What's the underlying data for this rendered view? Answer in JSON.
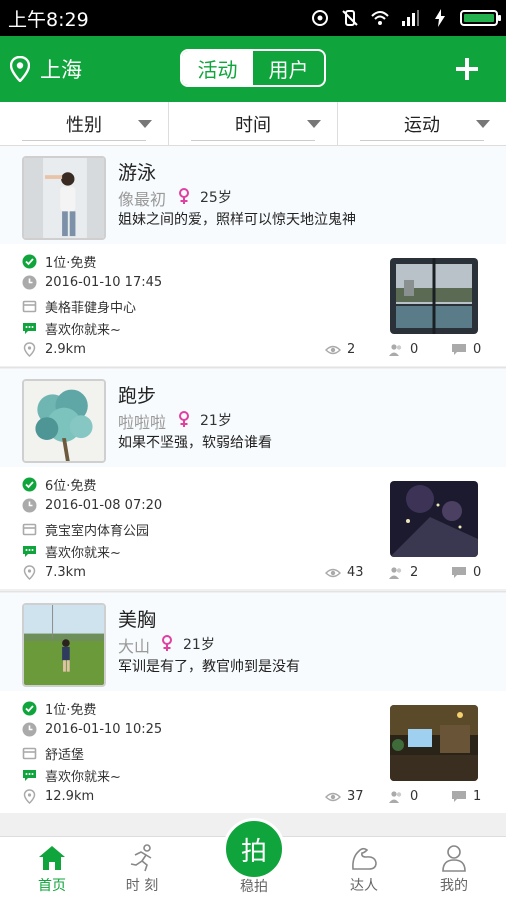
{
  "status_bar": {
    "time": "上午8:29"
  },
  "header": {
    "location": "上海",
    "tabs": [
      {
        "label": "活动"
      },
      {
        "label": "用户"
      }
    ]
  },
  "filters": [
    {
      "label": "性别"
    },
    {
      "label": "时间"
    },
    {
      "label": "运动"
    }
  ],
  "colors": {
    "brand": "#10a53c",
    "gender_female": "#e040a0"
  },
  "activities": [
    {
      "title": "游泳",
      "name": "像最初",
      "age": "25岁",
      "quote": "姐妹之间的爱，照样可以惊天地泣鬼神",
      "slots": "1位·免费",
      "datetime": "2016-01-10 17:45",
      "venue": "美格菲健身中心",
      "note": "喜欢你就来~",
      "distance": "2.9km",
      "views": "2",
      "participants": "0",
      "comments": "0"
    },
    {
      "title": "跑步",
      "name": "啦啦啦",
      "age": "21岁",
      "quote": "如果不坚强，软弱给谁看",
      "slots": "6位·免费",
      "datetime": "2016-01-08 07:20",
      "venue": "竟宝室内体育公园",
      "note": "喜欢你就来~",
      "distance": "7.3km",
      "views": "43",
      "participants": "2",
      "comments": "0"
    },
    {
      "title": "美胸",
      "name": "大山",
      "age": "21岁",
      "quote": "军训是有了，教官帅到是没有",
      "slots": "1位·免费",
      "datetime": "2016-01-10 10:25",
      "venue": "舒适堡",
      "note": "喜欢你就来~",
      "distance": "12.9km",
      "views": "37",
      "participants": "0",
      "comments": "1"
    }
  ],
  "bottom_nav": {
    "home": "首页",
    "moment": "时 刻",
    "shoot": "拍",
    "shoot_label": "稳拍",
    "experts": "达人",
    "mine": "我的"
  }
}
